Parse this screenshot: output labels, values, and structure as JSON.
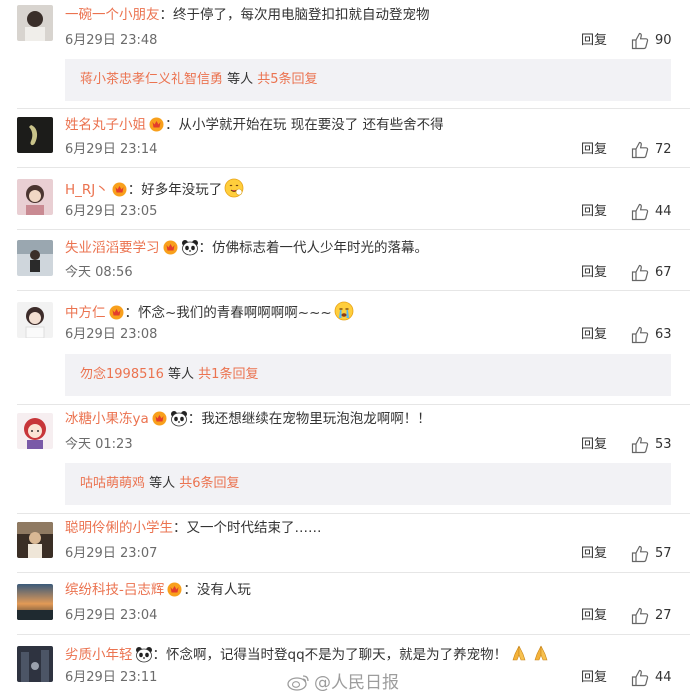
{
  "colors": {
    "username": "#eb7350",
    "text": "#333333",
    "time": "#6b6b6b",
    "reply_box_bg": "#f2f2f5"
  },
  "labels": {
    "reply": "回复",
    "like_icon": "thumbs-up-icon"
  },
  "comments": [
    {
      "user": "一碗一个小朋友",
      "sep": "：",
      "text": "终于停了，每次用电脑登扣扣就自动登宠物",
      "time": "6月29日 23:48",
      "likes": "90",
      "replies": {
        "names": "蒋小茶忠孝仁义礼智信勇",
        "mid": " 等人 ",
        "count": "共5条回复"
      }
    },
    {
      "user": "姓名丸子小姐",
      "sep": "：",
      "text": "从小学就开始在玩 现在要没了 还有些舍不得",
      "time": "6月29日 23:14",
      "likes": "72"
    },
    {
      "user": "H_RJ丶",
      "sep": "：",
      "text": "好多年没玩了",
      "time": "6月29日 23:05",
      "likes": "44"
    },
    {
      "user": "失业滔滔要学习",
      "sep": "：",
      "text": "仿佛标志着一代人少年时光的落幕。",
      "time": "今天 08:56",
      "likes": "67"
    },
    {
      "user": "中方仁",
      "sep": "：",
      "text": "怀念~我们的青春啊啊啊啊~~~",
      "time": "6月29日 23:08",
      "likes": "63",
      "replies": {
        "names": "勿念1998516",
        "mid": " 等人 ",
        "count": "共1条回复"
      }
    },
    {
      "user": "冰糖小果冻ya",
      "sep": "：",
      "text": "我还想继续在宠物里玩泡泡龙啊啊！！",
      "time": "今天 01:23",
      "likes": "53",
      "replies": {
        "names": "咕咕萌萌鸡",
        "mid": " 等人 ",
        "count": "共6条回复"
      }
    },
    {
      "user": "聪明伶俐的小学生",
      "sep": "：",
      "text": "又一个时代结束了……",
      "time": "6月29日 23:07",
      "likes": "57"
    },
    {
      "user": "缤纷科技-吕志辉",
      "sep": "：",
      "text": "没有人玩",
      "time": "6月29日 23:04",
      "likes": "27"
    },
    {
      "user": "劣质小年轻",
      "sep": "：",
      "text": "怀念啊，记得当时登qq不是为了聊天，就是为了养宠物！",
      "time": "6月29日 23:11",
      "likes": "44"
    }
  ],
  "watermark": {
    "text": "@人民日报"
  }
}
